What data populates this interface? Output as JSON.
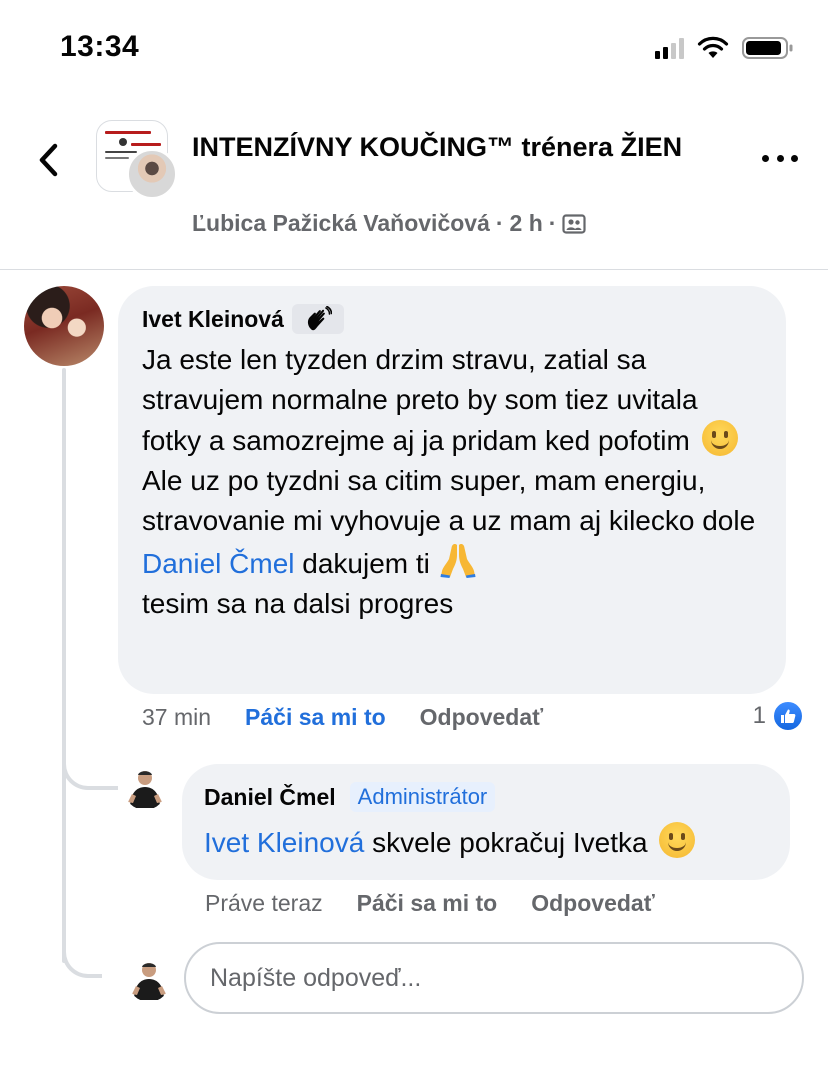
{
  "status_bar": {
    "time": "13:34"
  },
  "header": {
    "group_name": "INTENZÍVNY KOUČING™ trénera ŽIEN",
    "poster_name": "Ľubica Pažická Vaňovičová",
    "separator": "·",
    "post_age": "2 h",
    "audience_icon": "group-audience-icon"
  },
  "comments": [
    {
      "author": "Ivet Kleinová",
      "badge_icon": "waving-hand-icon",
      "text_parts": {
        "p1": "Ja este len tyzden drzim stravu, zatial sa stravujem normalne preto by som tiez uvitala fotky a samozrejme aj ja pridam ked pofotim",
        "p2_before": "Ale uz po tyzdni sa citim super, mam energiu, stravovanie mi vyhovuje a uz mam aj kilecko dole",
        "p2_mention": "Daniel Čmel",
        "p2_after": "dakujem ti",
        "p2_end": "tesim sa na dalsi progres"
      },
      "time": "37 min",
      "like_label": "Páči sa mi to",
      "reply_label": "Odpovedať",
      "reaction_count": "1"
    },
    {
      "author": "Daniel Čmel",
      "role_badge": "Administrátor",
      "mention": "Ivet Kleinová",
      "text": "skvele pokračuj Ivetka",
      "time": "Práve teraz",
      "like_label": "Páči sa mi to",
      "reply_label": "Odpovedať"
    }
  ],
  "composer": {
    "placeholder": "Napíšte odpoveď..."
  },
  "colors": {
    "accent": "#216fdb",
    "bubble": "#f0f2f5",
    "secondary_text": "#65676b"
  }
}
